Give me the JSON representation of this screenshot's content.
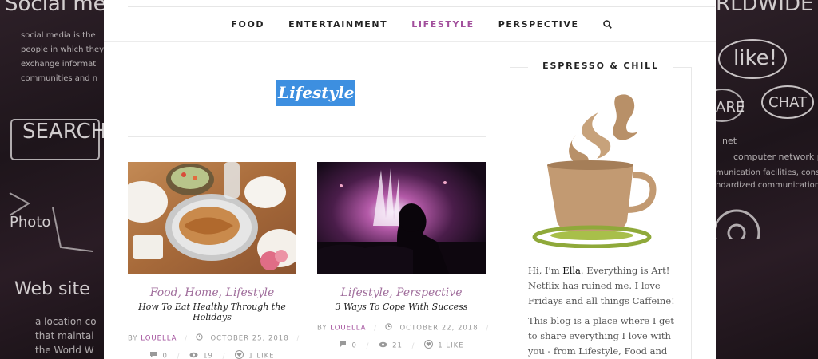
{
  "nav": {
    "items": [
      {
        "label": "FOOD",
        "active": false
      },
      {
        "label": "ENTERTAINMENT",
        "active": false
      },
      {
        "label": "LIFESTYLE",
        "active": true
      },
      {
        "label": "PERSPECTIVE",
        "active": false
      }
    ],
    "search_icon": "search-icon"
  },
  "category": {
    "title": "Lifestyle"
  },
  "posts": [
    {
      "categories": "Food, Home, Lifestyle",
      "title": "How To Eat Healthy Through the Holidays",
      "by": "BY",
      "author": "LOUELLA",
      "date": "OCTOBER 25, 2018",
      "comments": "0",
      "views": "19",
      "likes": "1 LIKE"
    },
    {
      "categories": "Lifestyle, Perspective",
      "title": "3 Ways To Cope With Success",
      "by": "BY",
      "author": "LOUELLA",
      "date": "OCTOBER 22, 2018",
      "comments": "0",
      "views": "21",
      "likes": "1 LIKE"
    }
  ],
  "sidebar": {
    "title": "ESPRESSO & CHILL",
    "about_intro": "Hi, I'm",
    "about_name": "Ella",
    "about_rest": ". Everything is Art! Netflix has ruined me. I love Fridays and all things Caffeine!",
    "about_p2": "This blog is a place where I get to share everything I love with you - from Lifestyle, Food and Art to"
  },
  "background": {
    "left": [
      "Social media",
      "social media is the",
      "people in which they",
      "exchange informati",
      "communities and n",
      "SEARCH",
      "Photo",
      "Web site",
      "a location co",
      "that maintai",
      "the World W"
    ],
    "right": [
      "RLDWIDE",
      "like!",
      "ARE",
      "CHAT",
      "net",
      "computer network pro",
      "munication facilities, consi",
      "ndardized communication"
    ]
  },
  "colors": {
    "accent": "#a24f9c",
    "highlight": "#3d8fe0"
  }
}
